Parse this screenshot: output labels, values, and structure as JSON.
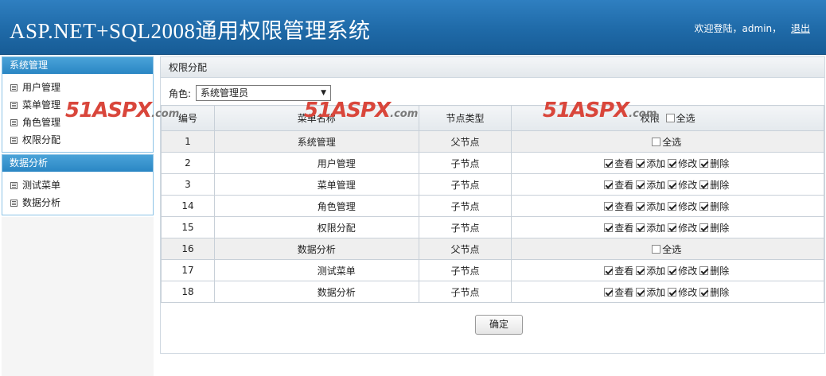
{
  "header": {
    "title": "ASP.NET+SQL2008通用权限管理系统",
    "welcome": "欢迎登陆，admin，",
    "logout": "退出"
  },
  "sidebar": {
    "groups": [
      {
        "title": "系统管理",
        "items": [
          "用户管理",
          "菜单管理",
          "角色管理",
          "权限分配"
        ]
      },
      {
        "title": "数据分析",
        "items": [
          "测试菜单",
          "数据分析"
        ]
      }
    ]
  },
  "main": {
    "panel_title": "权限分配",
    "role_label": "角色:",
    "role_value": "系统管理员",
    "table": {
      "headers": [
        "编号",
        "菜单名称",
        "节点类型",
        "权限",
        "全选"
      ],
      "rows": [
        {
          "id": "1",
          "name": "系统管理",
          "type": "父节点",
          "parent": true
        },
        {
          "id": "2",
          "name": "用户管理",
          "type": "子节点",
          "parent": false
        },
        {
          "id": "3",
          "name": "菜单管理",
          "type": "子节点",
          "parent": false
        },
        {
          "id": "14",
          "name": "角色管理",
          "type": "子节点",
          "parent": false
        },
        {
          "id": "15",
          "name": "权限分配",
          "type": "子节点",
          "parent": false
        },
        {
          "id": "16",
          "name": "数据分析",
          "type": "父节点",
          "parent": true
        },
        {
          "id": "17",
          "name": "测试菜单",
          "type": "子节点",
          "parent": false
        },
        {
          "id": "18",
          "name": "数据分析",
          "type": "子节点",
          "parent": false
        }
      ],
      "select_all": "全选",
      "perms": [
        "查看",
        "添加",
        "修改",
        "删除"
      ]
    },
    "ok_button": "确定"
  },
  "watermark": {
    "brand": "51ASPX",
    "suffix": ".com"
  }
}
